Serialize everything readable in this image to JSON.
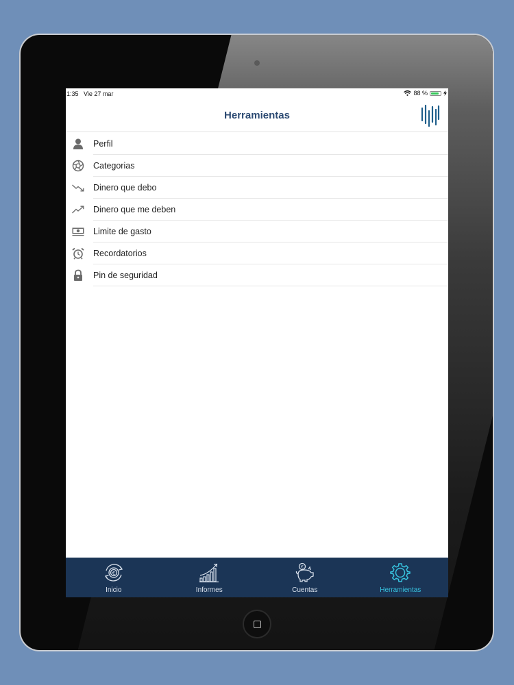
{
  "status_bar": {
    "time": "1:35",
    "date": "Vie 27 mar",
    "battery": "88 %",
    "battery_level": 0.88
  },
  "nav": {
    "title": "Herramientas",
    "logo_icon": "bars-logo-icon"
  },
  "menu": {
    "items": [
      {
        "label": "Perfil",
        "icon": "person-icon"
      },
      {
        "label": "Categorias",
        "icon": "aperture-icon"
      },
      {
        "label": "Dinero que debo",
        "icon": "trend-down-icon"
      },
      {
        "label": "Dinero que me deben",
        "icon": "trend-up-icon"
      },
      {
        "label": "Limite de gasto",
        "icon": "banknote-icon"
      },
      {
        "label": "Recordatorios",
        "icon": "alarm-clock-icon"
      },
      {
        "label": "Pin de seguridad",
        "icon": "lock-icon"
      }
    ]
  },
  "tabs": [
    {
      "label": "Inicio",
      "icon": "coin-cycle-icon",
      "active": false
    },
    {
      "label": "Informes",
      "icon": "bar-chart-icon",
      "active": false
    },
    {
      "label": "Cuentas",
      "icon": "piggy-bank-icon",
      "active": false
    },
    {
      "label": "Herramientas",
      "icon": "gear-icon",
      "active": true
    }
  ],
  "colors": {
    "background": "#6f8fb8",
    "title": "#2c4a72",
    "tab_bar": "#1b3556",
    "tab_active": "#38c4e0"
  }
}
